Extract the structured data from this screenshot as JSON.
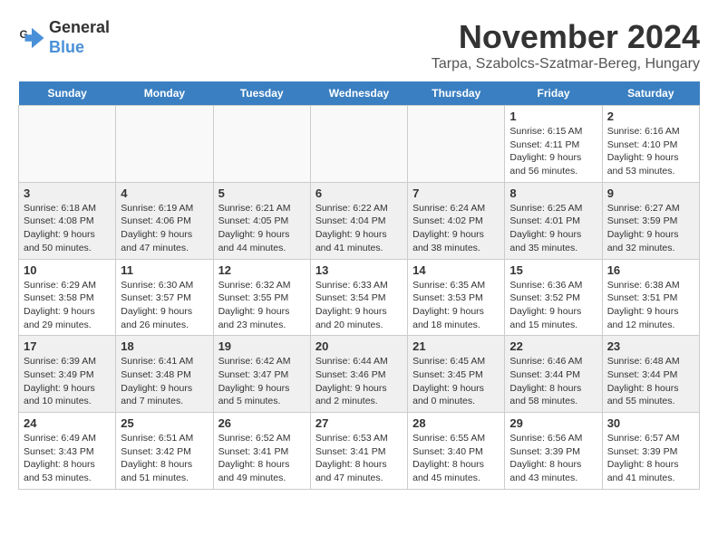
{
  "logo": {
    "line1": "General",
    "line2": "Blue"
  },
  "title": "November 2024",
  "location": "Tarpa, Szabolcs-Szatmar-Bereg, Hungary",
  "headers": [
    "Sunday",
    "Monday",
    "Tuesday",
    "Wednesday",
    "Thursday",
    "Friday",
    "Saturday"
  ],
  "weeks": [
    [
      {
        "day": "",
        "text": "",
        "empty": true
      },
      {
        "day": "",
        "text": "",
        "empty": true
      },
      {
        "day": "",
        "text": "",
        "empty": true
      },
      {
        "day": "",
        "text": "",
        "empty": true
      },
      {
        "day": "",
        "text": "",
        "empty": true
      },
      {
        "day": "1",
        "text": "Sunrise: 6:15 AM\nSunset: 4:11 PM\nDaylight: 9 hours and 56 minutes."
      },
      {
        "day": "2",
        "text": "Sunrise: 6:16 AM\nSunset: 4:10 PM\nDaylight: 9 hours and 53 minutes."
      }
    ],
    [
      {
        "day": "3",
        "text": "Sunrise: 6:18 AM\nSunset: 4:08 PM\nDaylight: 9 hours and 50 minutes."
      },
      {
        "day": "4",
        "text": "Sunrise: 6:19 AM\nSunset: 4:06 PM\nDaylight: 9 hours and 47 minutes."
      },
      {
        "day": "5",
        "text": "Sunrise: 6:21 AM\nSunset: 4:05 PM\nDaylight: 9 hours and 44 minutes."
      },
      {
        "day": "6",
        "text": "Sunrise: 6:22 AM\nSunset: 4:04 PM\nDaylight: 9 hours and 41 minutes."
      },
      {
        "day": "7",
        "text": "Sunrise: 6:24 AM\nSunset: 4:02 PM\nDaylight: 9 hours and 38 minutes."
      },
      {
        "day": "8",
        "text": "Sunrise: 6:25 AM\nSunset: 4:01 PM\nDaylight: 9 hours and 35 minutes."
      },
      {
        "day": "9",
        "text": "Sunrise: 6:27 AM\nSunset: 3:59 PM\nDaylight: 9 hours and 32 minutes."
      }
    ],
    [
      {
        "day": "10",
        "text": "Sunrise: 6:29 AM\nSunset: 3:58 PM\nDaylight: 9 hours and 29 minutes."
      },
      {
        "day": "11",
        "text": "Sunrise: 6:30 AM\nSunset: 3:57 PM\nDaylight: 9 hours and 26 minutes."
      },
      {
        "day": "12",
        "text": "Sunrise: 6:32 AM\nSunset: 3:55 PM\nDaylight: 9 hours and 23 minutes."
      },
      {
        "day": "13",
        "text": "Sunrise: 6:33 AM\nSunset: 3:54 PM\nDaylight: 9 hours and 20 minutes."
      },
      {
        "day": "14",
        "text": "Sunrise: 6:35 AM\nSunset: 3:53 PM\nDaylight: 9 hours and 18 minutes."
      },
      {
        "day": "15",
        "text": "Sunrise: 6:36 AM\nSunset: 3:52 PM\nDaylight: 9 hours and 15 minutes."
      },
      {
        "day": "16",
        "text": "Sunrise: 6:38 AM\nSunset: 3:51 PM\nDaylight: 9 hours and 12 minutes."
      }
    ],
    [
      {
        "day": "17",
        "text": "Sunrise: 6:39 AM\nSunset: 3:49 PM\nDaylight: 9 hours and 10 minutes."
      },
      {
        "day": "18",
        "text": "Sunrise: 6:41 AM\nSunset: 3:48 PM\nDaylight: 9 hours and 7 minutes."
      },
      {
        "day": "19",
        "text": "Sunrise: 6:42 AM\nSunset: 3:47 PM\nDaylight: 9 hours and 5 minutes."
      },
      {
        "day": "20",
        "text": "Sunrise: 6:44 AM\nSunset: 3:46 PM\nDaylight: 9 hours and 2 minutes."
      },
      {
        "day": "21",
        "text": "Sunrise: 6:45 AM\nSunset: 3:45 PM\nDaylight: 9 hours and 0 minutes."
      },
      {
        "day": "22",
        "text": "Sunrise: 6:46 AM\nSunset: 3:44 PM\nDaylight: 8 hours and 58 minutes."
      },
      {
        "day": "23",
        "text": "Sunrise: 6:48 AM\nSunset: 3:44 PM\nDaylight: 8 hours and 55 minutes."
      }
    ],
    [
      {
        "day": "24",
        "text": "Sunrise: 6:49 AM\nSunset: 3:43 PM\nDaylight: 8 hours and 53 minutes."
      },
      {
        "day": "25",
        "text": "Sunrise: 6:51 AM\nSunset: 3:42 PM\nDaylight: 8 hours and 51 minutes."
      },
      {
        "day": "26",
        "text": "Sunrise: 6:52 AM\nSunset: 3:41 PM\nDaylight: 8 hours and 49 minutes."
      },
      {
        "day": "27",
        "text": "Sunrise: 6:53 AM\nSunset: 3:41 PM\nDaylight: 8 hours and 47 minutes."
      },
      {
        "day": "28",
        "text": "Sunrise: 6:55 AM\nSunset: 3:40 PM\nDaylight: 8 hours and 45 minutes."
      },
      {
        "day": "29",
        "text": "Sunrise: 6:56 AM\nSunset: 3:39 PM\nDaylight: 8 hours and 43 minutes."
      },
      {
        "day": "30",
        "text": "Sunrise: 6:57 AM\nSunset: 3:39 PM\nDaylight: 8 hours and 41 minutes."
      }
    ]
  ]
}
